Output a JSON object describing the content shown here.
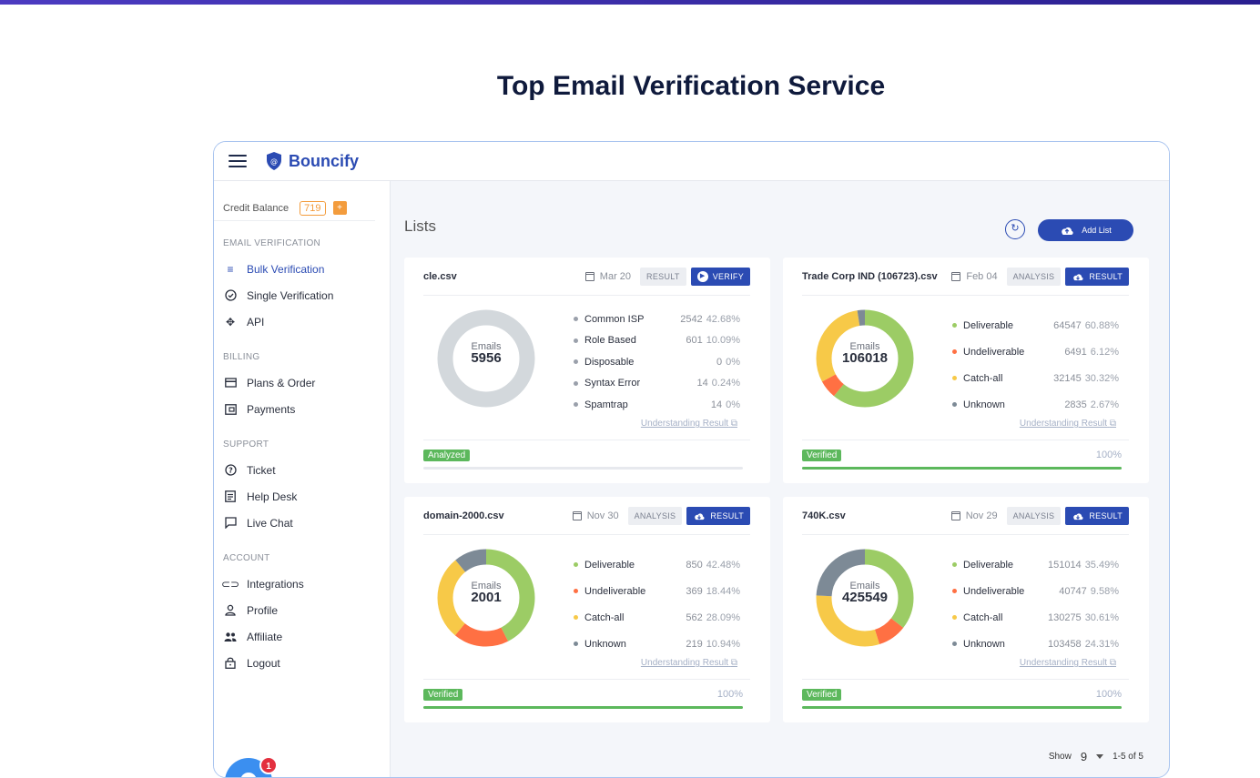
{
  "headline": "Top Email Verification Service",
  "app": {
    "name": "Bouncify"
  },
  "sidebar": {
    "credit_label": "Credit Balance",
    "credit_value": "719",
    "credit_plus": "+",
    "sections": {
      "email_verification": "EMAIL VERIFICATION",
      "billing": "BILLING",
      "support": "SUPPORT",
      "account": "ACCOUNT"
    },
    "items": {
      "bulk": "Bulk Verification",
      "single": "Single Verification",
      "api": "API",
      "plans": "Plans & Order",
      "payments": "Payments",
      "ticket": "Ticket",
      "helpdesk": "Help Desk",
      "livechat": "Live Chat",
      "integrations": "Integrations",
      "profile": "Profile",
      "affiliate": "Affiliate",
      "logout": "Logout"
    }
  },
  "chat_badge": "1",
  "main": {
    "title": "Lists",
    "add_list": "Add List",
    "understanding": "Understanding Result",
    "emails_label": "Emails",
    "pager": {
      "show": "Show",
      "per_page": "9",
      "range": "1-5 of 5"
    }
  },
  "colors": {
    "deliverable": "#9ccc65",
    "undeliverable": "#ff7043",
    "catchall": "#f7c948",
    "unknown": "#7d8a96",
    "analyzed_gray": "#d3d8dc",
    "brand": "#2b4bb3"
  },
  "cards": [
    {
      "file": "cle.csv",
      "date": "Mar 20",
      "btn_gray": "RESULT",
      "btn_blue": "VERIFY",
      "btn_icon": "play-icon",
      "emails": "5956",
      "legend": [
        {
          "name": "Common ISP",
          "count": "2542",
          "pct": "42.68%"
        },
        {
          "name": "Role Based",
          "count": "601",
          "pct": "10.09%"
        },
        {
          "name": "Disposable",
          "count": "0",
          "pct": "0%"
        },
        {
          "name": "Syntax Error",
          "count": "14",
          "pct": "0.24%"
        },
        {
          "name": "Spamtrap",
          "count": "14",
          "pct": "0%"
        }
      ],
      "status": "Analyzed",
      "progress_text": "",
      "progress": 0
    },
    {
      "file": "Trade Corp IND (106723).csv",
      "date": "Feb 04",
      "btn_gray": "ANALYSIS",
      "btn_blue": "RESULT",
      "btn_icon": "cloud-download-icon",
      "emails": "106018",
      "legend": [
        {
          "name": "Deliverable",
          "count": "64547",
          "pct": "60.88%"
        },
        {
          "name": "Undeliverable",
          "count": "6491",
          "pct": "6.12%"
        },
        {
          "name": "Catch-all",
          "count": "32145",
          "pct": "30.32%"
        },
        {
          "name": "Unknown",
          "count": "2835",
          "pct": "2.67%"
        }
      ],
      "status": "Verified",
      "progress_text": "100%",
      "progress": 1
    },
    {
      "file": "domain-2000.csv",
      "date": "Nov 30",
      "btn_gray": "ANALYSIS",
      "btn_blue": "RESULT",
      "btn_icon": "cloud-download-icon",
      "emails": "2001",
      "legend": [
        {
          "name": "Deliverable",
          "count": "850",
          "pct": "42.48%"
        },
        {
          "name": "Undeliverable",
          "count": "369",
          "pct": "18.44%"
        },
        {
          "name": "Catch-all",
          "count": "562",
          "pct": "28.09%"
        },
        {
          "name": "Unknown",
          "count": "219",
          "pct": "10.94%"
        }
      ],
      "status": "Verified",
      "progress_text": "100%",
      "progress": 1
    },
    {
      "file": "740K.csv",
      "date": "Nov 29",
      "btn_gray": "ANALYSIS",
      "btn_blue": "RESULT",
      "btn_icon": "cloud-download-icon",
      "emails": "425549",
      "legend": [
        {
          "name": "Deliverable",
          "count": "151014",
          "pct": "35.49%"
        },
        {
          "name": "Undeliverable",
          "count": "40747",
          "pct": "9.58%"
        },
        {
          "name": "Catch-all",
          "count": "130275",
          "pct": "30.61%"
        },
        {
          "name": "Unknown",
          "count": "103458",
          "pct": "24.31%"
        }
      ],
      "status": "Verified",
      "progress_text": "100%",
      "progress": 1
    }
  ]
}
